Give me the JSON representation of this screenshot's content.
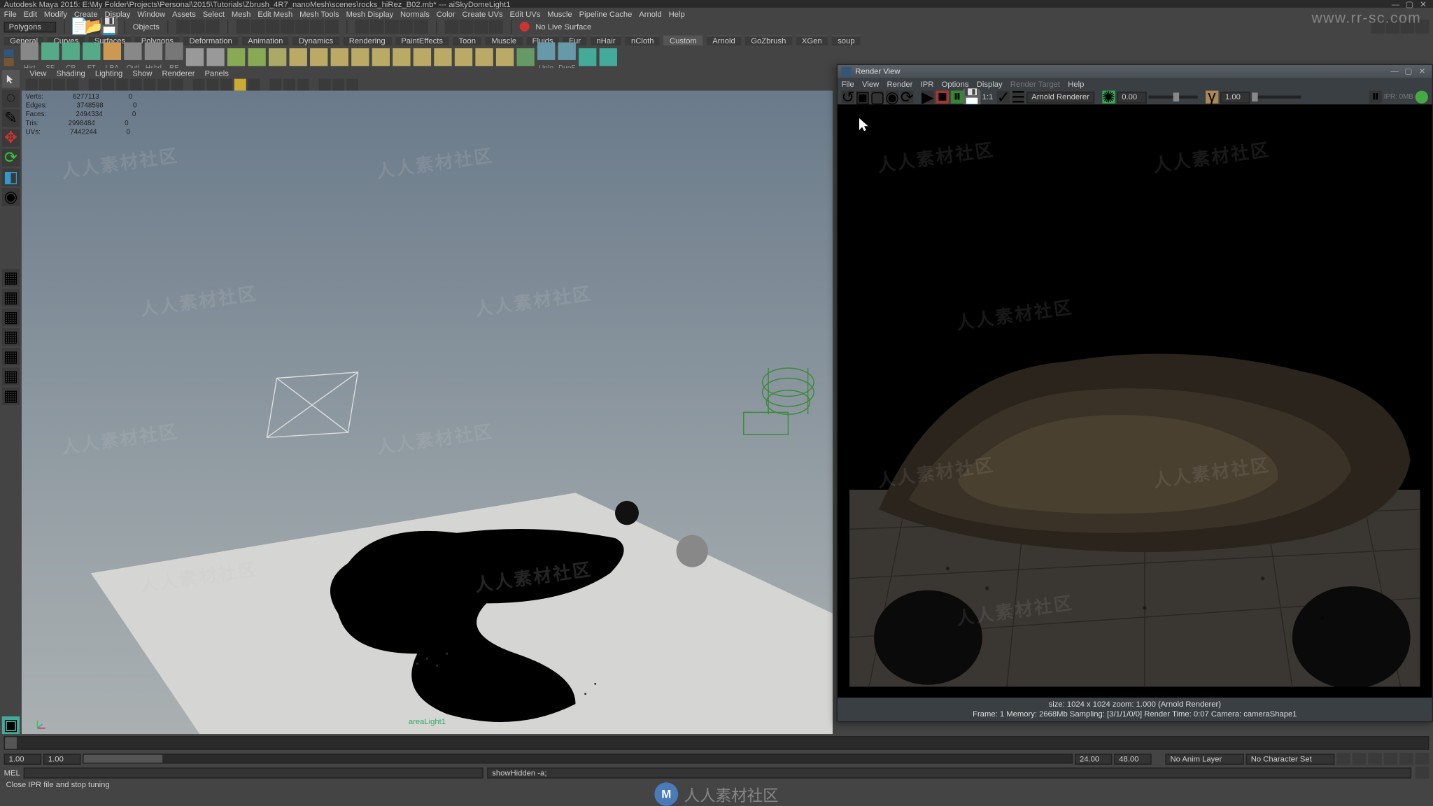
{
  "title": "Autodesk Maya 2015: E:\\My Folder\\Projects\\Personal\\2015\\Tutorials\\Zbrush_4R7_nanoMesh\\scenes\\rocks_hiRez_B02.mb* --- aiSkyDomeLight1",
  "top_url": "www.rr-sc.com",
  "menubar": [
    "File",
    "Edit",
    "Modify",
    "Create",
    "Display",
    "Window",
    "Assets",
    "Select",
    "Mesh",
    "Edit Mesh",
    "Mesh Tools",
    "Mesh Display",
    "Normals",
    "Color",
    "Create UVs",
    "Edit UVs",
    "Muscle",
    "Pipeline Cache",
    "Arnold",
    "Help"
  ],
  "mode": {
    "select": "Polygons",
    "objects_label": "Objects",
    "no_live_surface": "No Live Surface"
  },
  "shelf_tabs": [
    "General",
    "Curves",
    "Surfaces",
    "Polygons",
    "Deformation",
    "Animation",
    "Dynamics",
    "Rendering",
    "PaintEffects",
    "Toon",
    "Muscle",
    "Fluids",
    "Fur",
    "nHair",
    "nCloth",
    "Custom",
    "Arnold",
    "GoZbrush",
    "XGen",
    "soup"
  ],
  "shelf_active": "Custom",
  "shelf_btn_labels": [
    "Hist",
    "SF",
    "CP",
    "FT",
    "",
    "LRA",
    "Outl",
    "Hshd",
    "RE",
    "",
    "",
    "",
    "",
    "",
    "",
    "",
    "",
    "",
    "",
    "",
    "",
    "",
    "",
    "",
    "",
    "",
    "",
    "UnIn",
    "DupF",
    "",
    ""
  ],
  "viewport": {
    "panel_menu": [
      "View",
      "Shading",
      "Lighting",
      "Show",
      "Renderer",
      "Panels"
    ],
    "label": "areaLight1",
    "hud": {
      "rows": [
        {
          "label": "Verts:",
          "a": "6277113",
          "b": "0"
        },
        {
          "label": "Edges:",
          "a": "3748598",
          "b": "0"
        },
        {
          "label": "Faces:",
          "a": "2494334",
          "b": "0"
        },
        {
          "label": "Tris:",
          "a": "2998484",
          "b": "0"
        },
        {
          "label": "UVs:",
          "a": "7442244",
          "b": "0"
        }
      ]
    }
  },
  "render_view": {
    "title": "Render View",
    "menu": [
      "File",
      "View",
      "Render",
      "IPR",
      "Options",
      "Display",
      "Render Target",
      "Help"
    ],
    "renderer": "Arnold Renderer",
    "ratio": "1:1",
    "exposure_field": "0.00",
    "gamma_field": "1.00",
    "status1": "size: 1024 x 1024  zoom: 1.000      (Arnold Renderer)",
    "status2": "Frame: 1    Memory: 2668Mb    Sampling: [3/1/1/0/0]    Render Time: 0:07    Camera: cameraShape1"
  },
  "timeline": {
    "start": "1.00",
    "cur": "1.00",
    "end": "24.00",
    "total": "48.00",
    "anim_layer": "No Anim Layer",
    "char_set": "No Character Set"
  },
  "cmd": {
    "mode": "MEL",
    "output": "showHidden -a;"
  },
  "status": "Close IPR file and stop tuning",
  "watermark_text": "人人素材社区",
  "footer_text": "人人素材社区"
}
